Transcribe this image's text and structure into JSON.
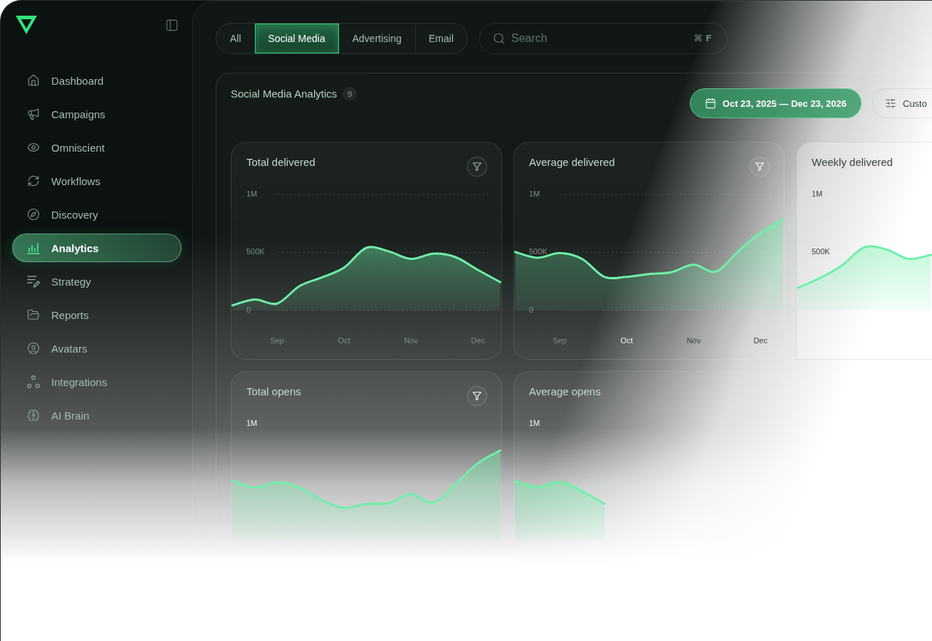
{
  "sidebar": {
    "items": [
      {
        "label": "Dashboard",
        "selected": false
      },
      {
        "label": "Campaigns",
        "selected": false
      },
      {
        "label": "Omniscient",
        "selected": false
      },
      {
        "label": "Workflows",
        "selected": false
      },
      {
        "label": "Discovery",
        "selected": false
      },
      {
        "label": "Analytics",
        "selected": true
      },
      {
        "label": "Strategy",
        "selected": false
      },
      {
        "label": "Reports",
        "selected": false
      },
      {
        "label": "Avatars",
        "selected": false
      },
      {
        "label": "Integrations",
        "selected": false
      },
      {
        "label": "AI Brain",
        "selected": false
      }
    ]
  },
  "filter_tabs": [
    {
      "label": "All",
      "selected": false
    },
    {
      "label": "Social Media",
      "selected": true
    },
    {
      "label": "Advertising",
      "selected": false
    },
    {
      "label": "Email",
      "selected": false
    }
  ],
  "search": {
    "placeholder": "Search",
    "shortcut": "⌘ F"
  },
  "panel": {
    "title": "Social Media Analytics",
    "count": "9",
    "date_range": "Oct 23, 2025 — Dec 23, 2026",
    "button_2": "Custo",
    "cards": [
      {
        "kind": "chart",
        "title": "Total delivered",
        "filter_button": true,
        "chart_data": {
          "type": "area",
          "categories": [
            null,
            null,
            "Sep",
            null,
            null,
            "Oct",
            null,
            null,
            "Nov",
            null,
            null,
            "Dec",
            null
          ],
          "series": [
            {
              "color": "#6ff0a8",
              "values": [
                45000,
                95000,
                60000,
                210000,
                285000,
                370000,
                540000,
                510000,
                445000,
                490000,
                460000,
                350000,
                245000
              ]
            }
          ],
          "ylim": [
            -417000,
            1448000
          ],
          "yticks": [
            {
              "value": 0,
              "label": "0"
            },
            {
              "value": 500000,
              "label": "500K"
            },
            {
              "value": 1000000,
              "label": "1M"
            }
          ],
          "grid": true
        }
      },
      {
        "kind": "chart",
        "title": "Average delivered",
        "filter_button": true,
        "chart_data": {
          "type": "area",
          "categories": [
            null,
            null,
            "Sep",
            null,
            null,
            "Oct",
            null,
            null,
            "Nov",
            null,
            null,
            "Dec",
            null
          ],
          "series": [
            {
              "color": "#6ff0a8",
              "values": [
                505000,
                455000,
                495000,
                445000,
                290000,
                290000,
                315000,
                330000,
                395000,
                335000,
                510000,
                670000,
                785000
              ]
            }
          ],
          "ylim": [
            -417000,
            1448000
          ],
          "yticks": [
            {
              "value": 0,
              "label": "0"
            },
            {
              "value": 500000,
              "label": "500K"
            },
            {
              "value": 1000000,
              "label": "1M"
            }
          ],
          "grid": true
        }
      },
      {
        "kind": "picture",
        "title": "Weekly delivered",
        "filter_button": false,
        "axis_labels": [
          "1M",
          "500K"
        ]
      },
      {
        "kind": "picture",
        "title": "Total opens",
        "filter_button": true,
        "axis_labels": [
          "1M"
        ]
      },
      {
        "kind": "picture",
        "title": "Average opens",
        "filter_button": false,
        "axis_labels": [
          "1M"
        ]
      }
    ]
  }
}
